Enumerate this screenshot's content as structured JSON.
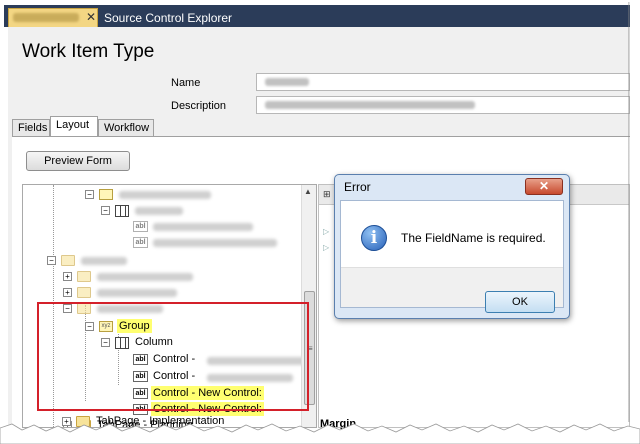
{
  "document_tabs": {
    "active_tab": "Initiative.wit",
    "close_glyph": "✕",
    "second_tab": "Source Control Explorer"
  },
  "header": {
    "title": "Work Item Type",
    "name_label": "Name",
    "name_value": "Initiative",
    "description_label": "Description",
    "description_value": "Tracks an strategic activity within the system."
  },
  "editor_tabs": {
    "fields": "Fields",
    "layout": "Layout",
    "workflow": "Workflow",
    "active": "Layout"
  },
  "toolbar": {
    "preview_label": "Preview Form"
  },
  "tree": {
    "items": [
      {
        "text": "Group - Classification",
        "blurred": true
      },
      {
        "text": "Column",
        "blurred": true
      },
      {
        "text": "Control - Business Area",
        "blurred": true
      },
      {
        "text": "Control - Project Category",
        "blurred": true
      },
      {
        "text": "TabGroup",
        "blurred": true
      },
      {
        "text": "TabPage - Justification",
        "blurred": true
      },
      {
        "text": "TabPage - Estimate",
        "blurred": true
      },
      {
        "text": "TabPage - Cost",
        "blurred": true
      },
      {
        "text": "Group",
        "highlighted": true
      },
      {
        "text": "Column"
      },
      {
        "text": "Control - ",
        "suffix": "Capital Investment Item"
      },
      {
        "text": "Control - ",
        "suffix": "Short Description"
      },
      {
        "text": "Control - New Control:",
        "highlighted": true
      },
      {
        "text": "Control - New Control:",
        "highlighted": true
      },
      {
        "text": "TabPage - Planning"
      },
      {
        "text": "TabPage - Implementation"
      }
    ]
  },
  "right_panel": {
    "footer_label": "Margin"
  },
  "dialog": {
    "title": "Error",
    "close_glyph": "✕",
    "icon_glyph": "i",
    "message": "The FieldName is required.",
    "ok_label": "OK"
  },
  "colors": {
    "highlight": "#ffff70",
    "annotation_box": "#d4202a",
    "tab_strip": "#2b3c59"
  }
}
